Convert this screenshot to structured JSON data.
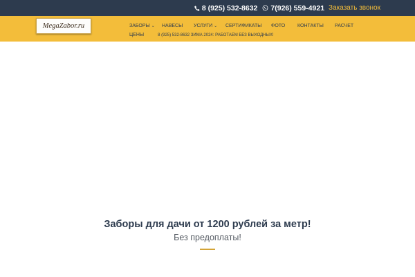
{
  "topbar": {
    "phone1": "8 (925) 532-8632",
    "phone2": "7(926) 559-4921",
    "callback_label": "Заказать звонок",
    "phone_icon": "phone-icon",
    "whatsapp_icon": "whatsapp-icon"
  },
  "logo": {
    "text": "MegaZabor.ru"
  },
  "nav": {
    "items": [
      {
        "label": "ЗАБОРЫ",
        "has_dropdown": true
      },
      {
        "label": "НАВЕСЫ",
        "has_dropdown": false
      },
      {
        "label": "УСЛУГИ",
        "has_dropdown": true
      },
      {
        "label": "СЕРТИФИКАТЫ",
        "has_dropdown": false
      },
      {
        "label": "ФОТО",
        "has_dropdown": false
      },
      {
        "label": "КОНТАКТЫ",
        "has_dropdown": false
      },
      {
        "label": "РАСЧЕТ",
        "has_dropdown": false
      },
      {
        "label": "ЦЕНЫ",
        "has_dropdown": false
      }
    ],
    "promo": "8 (925) 532-8632 ЗИМА 2024: РАБОТАЕМ БЕЗ ВЫХОДНЫХ!",
    "caret_glyph": "⌄"
  },
  "hero": {
    "title": "Заборы для дачи от 1200 рублей за метр!",
    "subtitle": "Без предоплаты!"
  },
  "colors": {
    "topbar_bg": "#2d3b4e",
    "nav_bg": "#f3bd3a",
    "accent": "#d4a437",
    "text_dark": "#2d3b4e"
  }
}
